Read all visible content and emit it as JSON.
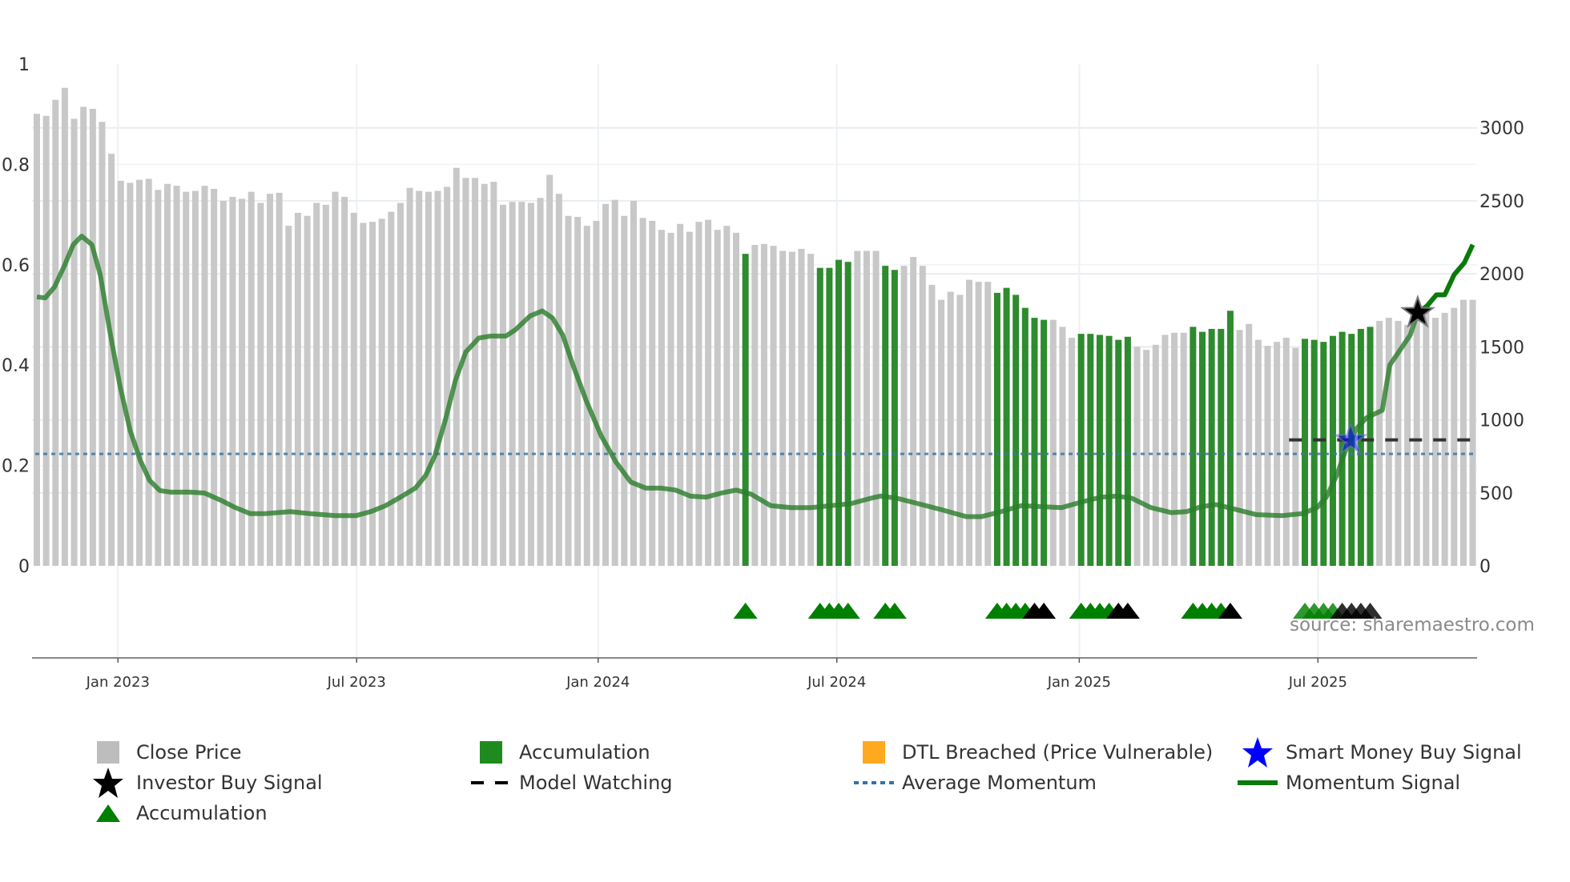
{
  "chart_data": {
    "type": "bar",
    "title": "",
    "x_unit": "week",
    "left_axis": {
      "ylim": [
        0,
        1
      ],
      "ticks": [
        0,
        0.2,
        0.4,
        0.6,
        0.8,
        1
      ],
      "tick_labels": [
        "0",
        "0.2",
        "0.4",
        "0.6",
        "0.8",
        "1"
      ]
    },
    "right_axis": {
      "ylim": [
        0,
        3437
      ],
      "ticks": [
        0,
        500,
        1000,
        1500,
        2000,
        2500,
        3000
      ],
      "tick_labels": [
        "0",
        "500",
        "1000",
        "1500",
        "2000",
        "2500",
        "3000"
      ]
    },
    "x_ticks": [
      {
        "week": 8.7,
        "label": "Jan 2023"
      },
      {
        "week": 34.3,
        "label": "Jul 2023"
      },
      {
        "week": 60.2,
        "label": "Jan 2024"
      },
      {
        "week": 85.8,
        "label": "Jul 2024"
      },
      {
        "week": 111.8,
        "label": "Jan 2025"
      },
      {
        "week": 137.4,
        "label": "Jul 2025"
      }
    ],
    "close_price": [
      3096,
      3082,
      3192,
      3274,
      3062,
      3144,
      3130,
      3041,
      2822,
      2637,
      2623,
      2644,
      2651,
      2575,
      2616,
      2603,
      2562,
      2568,
      2603,
      2582,
      2500,
      2527,
      2514,
      2562,
      2486,
      2548,
      2555,
      2329,
      2418,
      2397,
      2486,
      2473,
      2562,
      2527,
      2418,
      2349,
      2356,
      2377,
      2425,
      2486,
      2589,
      2568,
      2562,
      2568,
      2596,
      2726,
      2657,
      2657,
      2616,
      2630,
      2473,
      2493,
      2493,
      2486,
      2520,
      2678,
      2548,
      2397,
      2390,
      2329,
      2363,
      2479,
      2507,
      2397,
      2500,
      2383,
      2363,
      2301,
      2281,
      2342,
      2288,
      2356,
      2370,
      2301,
      2329,
      2281,
      2137,
      2198,
      2205,
      2192,
      2157,
      2151,
      2171,
      2137,
      2041,
      2041,
      2096,
      2082,
      2157,
      2157,
      2157,
      2055,
      2027,
      2055,
      2116,
      2055,
      1925,
      1822,
      1877,
      1856,
      1959,
      1945,
      1945,
      1870,
      1904,
      1856,
      1767,
      1699,
      1685,
      1685,
      1637,
      1562,
      1589,
      1589,
      1582,
      1575,
      1548,
      1569,
      1500,
      1479,
      1514,
      1582,
      1596,
      1596,
      1637,
      1603,
      1623,
      1623,
      1747,
      1616,
      1657,
      1548,
      1507,
      1534,
      1562,
      1493,
      1555,
      1548,
      1534,
      1575,
      1603,
      1589,
      1623,
      1637,
      1678,
      1699,
      1678,
      1651,
      1699,
      1753,
      1699,
      1733,
      1767,
      1822,
      1822
    ],
    "accumulation_weeks": [
      76,
      84,
      85,
      86,
      87,
      91,
      92,
      103,
      104,
      105,
      106,
      107,
      108,
      112,
      113,
      114,
      115,
      116,
      117,
      124,
      125,
      126,
      127,
      128,
      136,
      137,
      138,
      139,
      140,
      141,
      142,
      143
    ],
    "accumulation_triangles": [
      {
        "week": 76,
        "color": "green"
      },
      {
        "week": 84,
        "color": "green"
      },
      {
        "week": 85,
        "color": "green"
      },
      {
        "week": 86,
        "color": "green"
      },
      {
        "week": 87,
        "color": "green"
      },
      {
        "week": 91,
        "color": "green"
      },
      {
        "week": 92,
        "color": "green"
      },
      {
        "week": 103,
        "color": "green"
      },
      {
        "week": 104,
        "color": "green"
      },
      {
        "week": 105,
        "color": "green"
      },
      {
        "week": 106,
        "color": "green"
      },
      {
        "week": 107,
        "color": "black"
      },
      {
        "week": 108,
        "color": "black"
      },
      {
        "week": 112,
        "color": "green"
      },
      {
        "week": 113,
        "color": "green"
      },
      {
        "week": 114,
        "color": "green"
      },
      {
        "week": 115,
        "color": "green"
      },
      {
        "week": 116,
        "color": "black"
      },
      {
        "week": 117,
        "color": "black"
      },
      {
        "week": 124,
        "color": "green"
      },
      {
        "week": 125,
        "color": "green"
      },
      {
        "week": 126,
        "color": "green"
      },
      {
        "week": 127,
        "color": "green"
      },
      {
        "week": 128,
        "color": "black"
      },
      {
        "week": 136,
        "color": "green"
      },
      {
        "week": 137,
        "color": "green"
      },
      {
        "week": 138,
        "color": "green"
      },
      {
        "week": 139,
        "color": "green"
      },
      {
        "week": 140,
        "color": "black"
      },
      {
        "week": 141,
        "color": "black"
      },
      {
        "week": 142,
        "color": "black"
      },
      {
        "week": 143,
        "color": "black"
      }
    ],
    "momentum_signal": [
      [
        0,
        0.536
      ],
      [
        0.9,
        0.534
      ],
      [
        1.9,
        0.556
      ],
      [
        3.0,
        0.6
      ],
      [
        3.9,
        0.64
      ],
      [
        4.8,
        0.657
      ],
      [
        5.9,
        0.64
      ],
      [
        6.8,
        0.58
      ],
      [
        7.8,
        0.47
      ],
      [
        8.9,
        0.36
      ],
      [
        10.0,
        0.27
      ],
      [
        11.1,
        0.21
      ],
      [
        12.1,
        0.17
      ],
      [
        13.2,
        0.15
      ],
      [
        14.3,
        0.147
      ],
      [
        16.4,
        0.147
      ],
      [
        18.0,
        0.145
      ],
      [
        19.7,
        0.131
      ],
      [
        21.3,
        0.116
      ],
      [
        22.9,
        0.104
      ],
      [
        24.5,
        0.104
      ],
      [
        27.2,
        0.108
      ],
      [
        29.3,
        0.104
      ],
      [
        32.0,
        0.1
      ],
      [
        34.2,
        0.1
      ],
      [
        35.8,
        0.108
      ],
      [
        37.4,
        0.12
      ],
      [
        39.0,
        0.137
      ],
      [
        40.6,
        0.155
      ],
      [
        41.7,
        0.18
      ],
      [
        42.7,
        0.22
      ],
      [
        43.8,
        0.29
      ],
      [
        44.9,
        0.37
      ],
      [
        46.0,
        0.426
      ],
      [
        47.4,
        0.454
      ],
      [
        48.7,
        0.458
      ],
      [
        50.3,
        0.458
      ],
      [
        51.3,
        0.47
      ],
      [
        52.9,
        0.498
      ],
      [
        54.2,
        0.508
      ],
      [
        55.3,
        0.494
      ],
      [
        56.4,
        0.46
      ],
      [
        57.5,
        0.4
      ],
      [
        58.9,
        0.33
      ],
      [
        60.5,
        0.26
      ],
      [
        62.1,
        0.207
      ],
      [
        63.7,
        0.167
      ],
      [
        65.3,
        0.155
      ],
      [
        66.9,
        0.155
      ],
      [
        68.5,
        0.151
      ],
      [
        70.1,
        0.139
      ],
      [
        71.8,
        0.137
      ],
      [
        73.4,
        0.145
      ],
      [
        75.0,
        0.151
      ],
      [
        76.6,
        0.143
      ],
      [
        78.7,
        0.12
      ],
      [
        80.9,
        0.116
      ],
      [
        83.0,
        0.116
      ],
      [
        85.2,
        0.12
      ],
      [
        87.3,
        0.124
      ],
      [
        89.5,
        0.135
      ],
      [
        90.5,
        0.139
      ],
      [
        92.2,
        0.135
      ],
      [
        94.3,
        0.125
      ],
      [
        97.0,
        0.112
      ],
      [
        99.7,
        0.098
      ],
      [
        101.3,
        0.098
      ],
      [
        103.4,
        0.108
      ],
      [
        105.6,
        0.12
      ],
      [
        107.7,
        0.118
      ],
      [
        109.9,
        0.116
      ],
      [
        112.0,
        0.127
      ],
      [
        114.2,
        0.137
      ],
      [
        115.8,
        0.139
      ],
      [
        117.4,
        0.135
      ],
      [
        119.5,
        0.116
      ],
      [
        121.7,
        0.106
      ],
      [
        123.3,
        0.108
      ],
      [
        124.9,
        0.118
      ],
      [
        126.5,
        0.122
      ],
      [
        128.7,
        0.112
      ],
      [
        130.8,
        0.102
      ],
      [
        133.5,
        0.1
      ],
      [
        135.7,
        0.104
      ],
      [
        137.3,
        0.116
      ],
      [
        138.3,
        0.137
      ],
      [
        139.4,
        0.18
      ],
      [
        140.5,
        0.237
      ],
      [
        141.6,
        0.275
      ],
      [
        142.6,
        0.295
      ],
      [
        144.3,
        0.31
      ],
      [
        145.1,
        0.4
      ],
      [
        146.2,
        0.43
      ],
      [
        147.3,
        0.46
      ],
      [
        148.1,
        0.504
      ],
      [
        149.1,
        0.518
      ],
      [
        150.1,
        0.54
      ],
      [
        151.0,
        0.54
      ],
      [
        152.0,
        0.58
      ],
      [
        153.1,
        0.604
      ],
      [
        154.0,
        0.64
      ]
    ],
    "momentum_strong_from_week": 148.1,
    "average_momentum": 0.223,
    "model_watching": {
      "from_week": 134.3,
      "to_week": 154.0,
      "value": 0.251
    },
    "smart_money_buy_signal": {
      "week": 140.9,
      "value": 0.251
    },
    "investor_buy_signal": {
      "week": 148.1,
      "value": 0.504
    },
    "colors": {
      "price": "#c8c8c8",
      "accumulation": "#2e8b2e",
      "triangle_green": "#008000",
      "triangle_black": "#000000",
      "momentum": "#2a7d2a",
      "momentum_strong": "#0a7a0a",
      "average": "#3a76a8",
      "smart_money": "#0000ff",
      "dtl": "#ffa91f"
    },
    "legend_position": "bottom"
  },
  "legend": {
    "close_price": "Close Price",
    "accumulation_bar": "Accumulation",
    "dtl_breached": "DTL Breached (Price Vulnerable)",
    "smart_money": "Smart Money Buy Signal",
    "investor_buy": "Investor Buy Signal",
    "model_watching": "Model Watching",
    "average_momentum": "Average Momentum",
    "momentum_signal": "Momentum Signal",
    "accumulation_triangle": "Accumulation"
  },
  "source": "source: sharemaestro.com"
}
